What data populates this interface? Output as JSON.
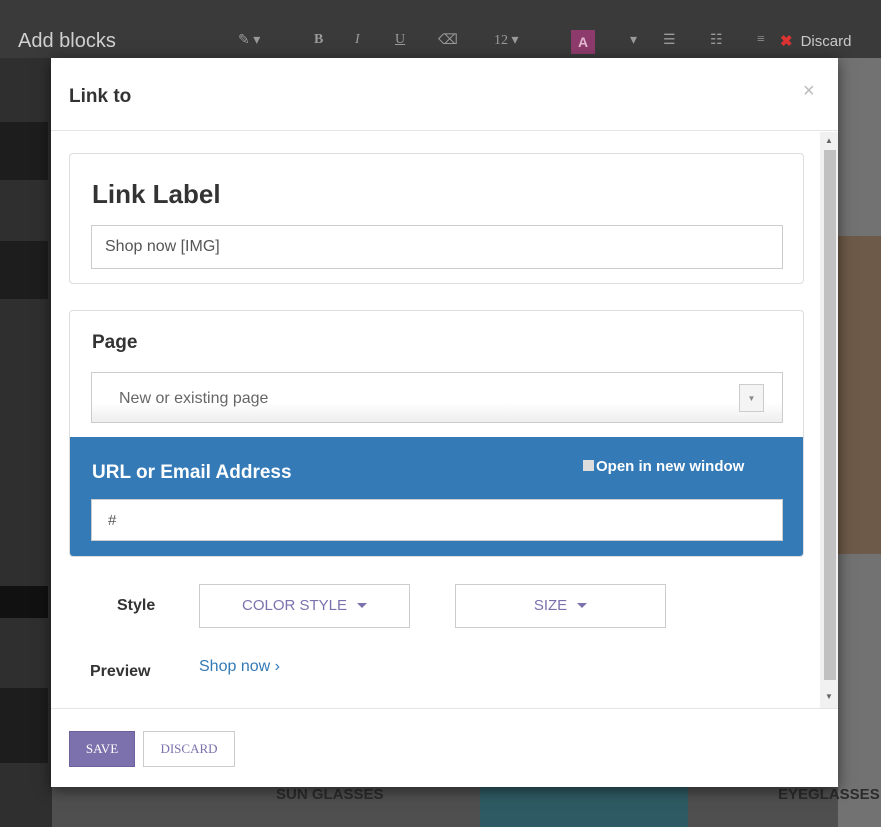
{
  "editor": {
    "title": "Add blocks",
    "font_size": "12",
    "font_color_letter": "A",
    "discard_label": "Discard",
    "background_labels": [
      "SUN GLASSES",
      "EYEGLASSES"
    ]
  },
  "modal": {
    "title": "Link to",
    "close_symbol": "×",
    "link_label": {
      "heading": "Link Label",
      "value": "Shop now [IMG]"
    },
    "page": {
      "heading": "Page",
      "placeholder": "New or existing page",
      "arrow": "▼"
    },
    "url": {
      "heading": "URL or Email Address",
      "new_window_label": "Open in new window",
      "value": "#"
    },
    "style": {
      "label": "Style",
      "color_style_label": "COLOR STYLE",
      "size_label": "SIZE"
    },
    "preview": {
      "label": "Preview",
      "link_text": "Shop now ›"
    },
    "footer": {
      "save_label": "SAVE",
      "discard_label": "DISCARD"
    }
  },
  "colors": {
    "primary_purple": "#7c71ad",
    "url_block_blue": "#337ab7"
  }
}
